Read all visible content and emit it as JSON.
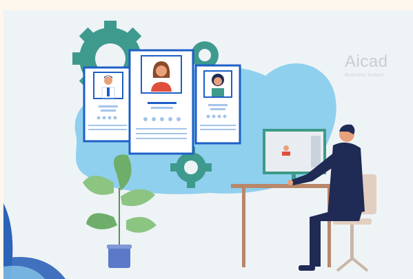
{
  "brand": {
    "name": "Aicad",
    "tagline": "Business School"
  },
  "illustration": {
    "profile_cards": [
      {
        "id": "left",
        "person": "man",
        "rating_stars": 4
      },
      {
        "id": "center",
        "person": "woman",
        "rating_stars": 5
      },
      {
        "id": "right",
        "person": "woman",
        "rating_stars": 4
      }
    ],
    "colors": {
      "card_border": "#1d5fc6",
      "gear": "#3f9a8e",
      "blob": "#8fd0ee",
      "suit": "#1f2a55",
      "chair": "#e2cfc2",
      "desk": "#b9876a",
      "plant": "#6fae6a",
      "pot": "#5b79c8"
    }
  }
}
